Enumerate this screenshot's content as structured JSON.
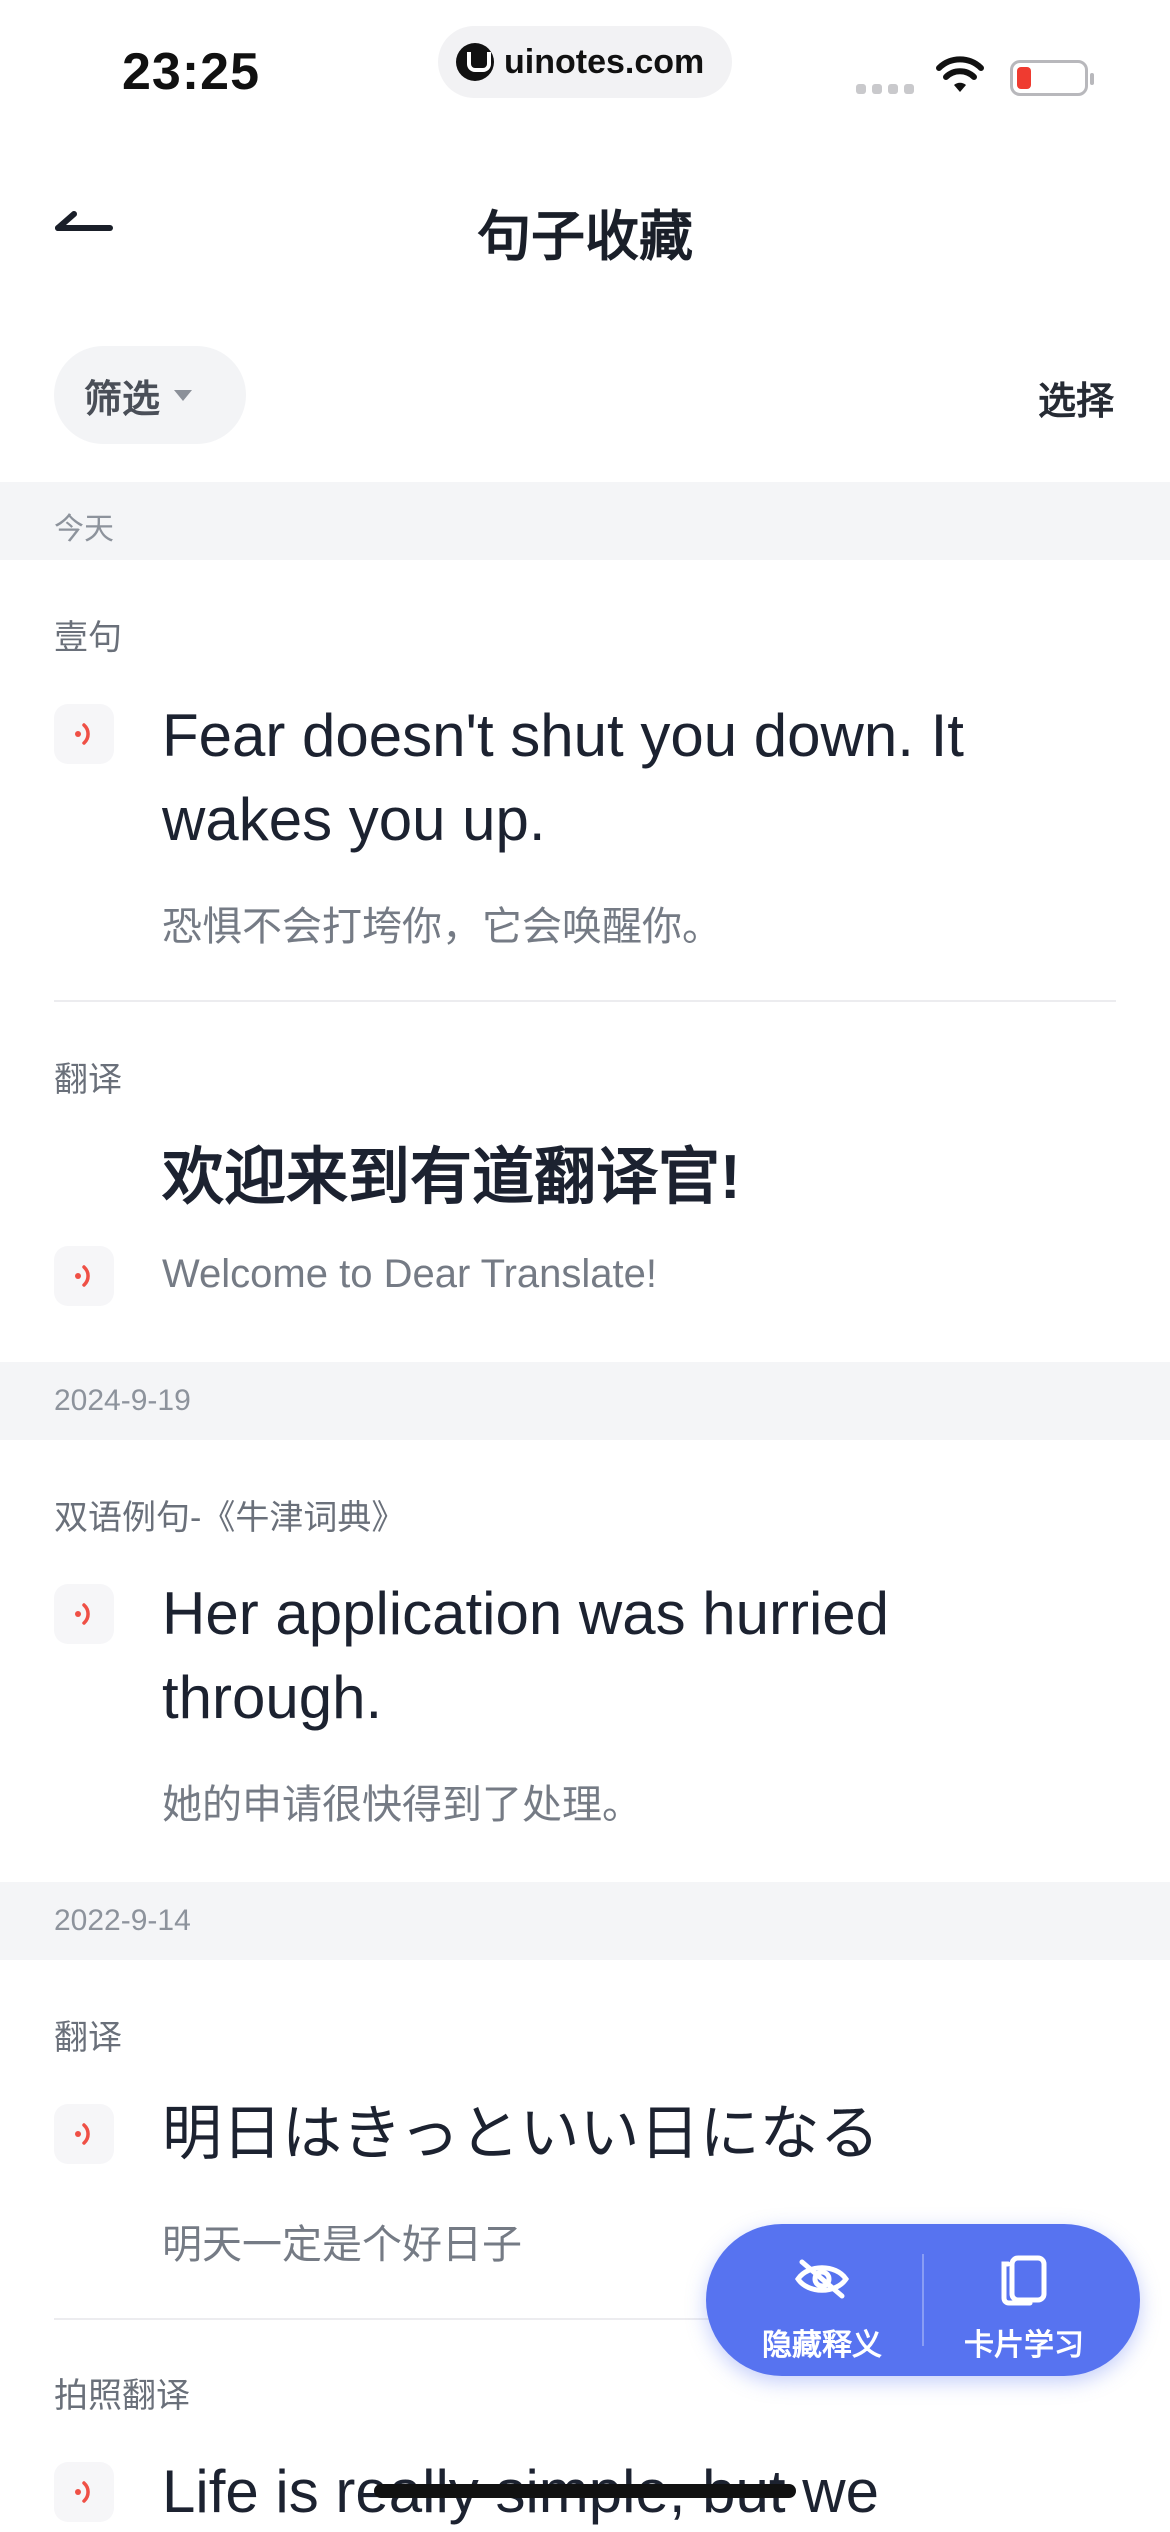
{
  "status_bar": {
    "time": "23:25",
    "url": "uinotes.com"
  },
  "header": {
    "title": "句子收藏"
  },
  "toolbar": {
    "filter_label": "筛选",
    "select_label": "选择"
  },
  "groups": [
    {
      "date": "今天",
      "items": [
        {
          "source": "壹句",
          "sentence": "Fear doesn't shut you down. It wakes you up.",
          "translation": "恐惧不会打垮你，它会唤醒你。"
        },
        {
          "source": "翻译",
          "sentence": "欢迎来到有道翻译官!",
          "translation": "Welcome to Dear Translate!"
        }
      ]
    },
    {
      "date": "2024-9-19",
      "items": [
        {
          "source": "双语例句-《牛津词典》",
          "sentence": "Her application was hurried through.",
          "translation": "她的申请很快得到了处理。"
        }
      ]
    },
    {
      "date": "2022-9-14",
      "items": [
        {
          "source": "翻译",
          "sentence": "明日はきっといい日になる",
          "translation": "明天一定是个好日子"
        },
        {
          "source": "拍照翻译",
          "sentence": "Life is really simple, but we"
        }
      ]
    }
  ],
  "fab": {
    "hide_label": "隐藏释义",
    "card_label": "卡片学习"
  },
  "colors": {
    "accent": "#5773f0",
    "speaker": "#ef5046",
    "battery_low": "#ef3b30"
  },
  "icons": [
    "back-arrow-icon",
    "caret-down-icon",
    "speaker-icon",
    "eye-hidden-icon",
    "cards-icon",
    "wifi-icon",
    "battery-icon"
  ]
}
